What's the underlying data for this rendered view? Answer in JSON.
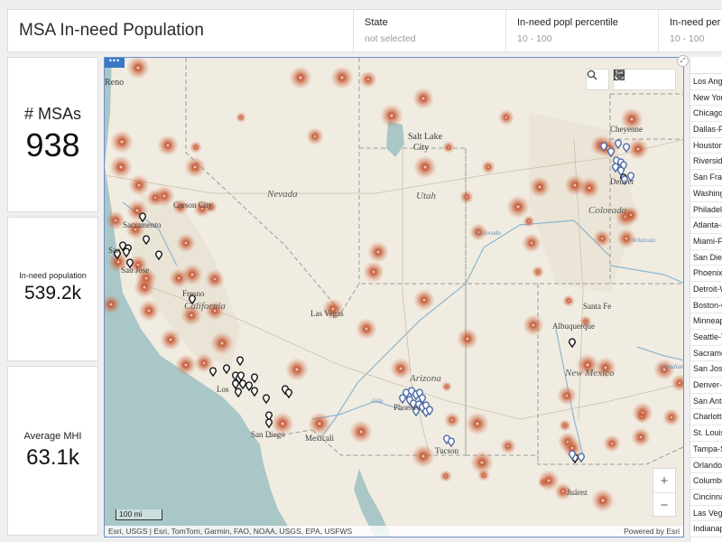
{
  "header": {
    "title": "MSA In-need Population",
    "filters": [
      {
        "label": "State",
        "value": "not selected"
      },
      {
        "label": "In-need popl percentile",
        "value": "10 - 100"
      },
      {
        "label": "In-need per E",
        "value": "10 - 100"
      }
    ]
  },
  "cards": [
    {
      "label": "# MSAs",
      "value": "938"
    },
    {
      "label": "In-need population",
      "value": "539.2k"
    },
    {
      "label": "Average MHI",
      "value": "63.1k"
    }
  ],
  "map": {
    "place_labels": [
      {
        "text": "Reno"
      },
      {
        "text": "Salt Lake"
      },
      {
        "text": "City"
      },
      {
        "text": "Cheyenne"
      },
      {
        "text": "Nevada"
      },
      {
        "text": "Utah"
      },
      {
        "text": "Carson City"
      },
      {
        "text": "Sacramento"
      },
      {
        "text": "Colorado"
      },
      {
        "text": "San"
      },
      {
        "text": "San Jose"
      },
      {
        "text": "Fresno"
      },
      {
        "text": "California"
      },
      {
        "text": "Las Vegas"
      },
      {
        "text": "Santa Fe"
      },
      {
        "text": "Albuquerque"
      },
      {
        "text": "New Mexico"
      },
      {
        "text": "Arizona"
      },
      {
        "text": "Phoenix"
      },
      {
        "text": "Los"
      },
      {
        "text": "San Diego"
      },
      {
        "text": "Mexicali"
      },
      {
        "text": "Tucson"
      },
      {
        "text": "Juárez"
      },
      {
        "text": "Gila"
      },
      {
        "text": "Colorado"
      },
      {
        "text": "Arkansas"
      },
      {
        "text": "Canadian"
      },
      {
        "text": "Denver"
      }
    ],
    "attribution": "Esri, USGS | Esri, TomTom, Garmin, FAO, NOAA, USGS, EPA, USFWS",
    "powered_by": "Powered by Esri",
    "scale_label": "100 mi",
    "zoom_in": "+",
    "zoom_out": "−",
    "menu_dots": "•••"
  },
  "msa_list": [
    "Los Angeles",
    "New York",
    "Chicago",
    "Dallas-Fort Worth",
    "Houston",
    "Riverside",
    "San Francisco",
    "Washington",
    "Philadelphia",
    "Atlanta-Sandy Springs",
    "Miami-Fort Lauderdale",
    "San Diego",
    "Phoenix-Mesa",
    "Detroit-Warren",
    "Boston-Cambridge",
    "Minneapolis",
    "Seattle-Tacoma",
    "Sacramento",
    "San Jose",
    "Denver-Aurora",
    "San Antonio",
    "Charlotte",
    "St. Louis",
    "Tampa-St. Petersburg",
    "Orlando",
    "Columbus",
    "Cincinnati",
    "Las Vegas",
    "Indianapolis"
  ],
  "colors": {
    "hotspot": "#b5482b",
    "pin_black": "#111111",
    "pin_blue": "#4a67a8",
    "border_accent": "#6f8fc7"
  }
}
